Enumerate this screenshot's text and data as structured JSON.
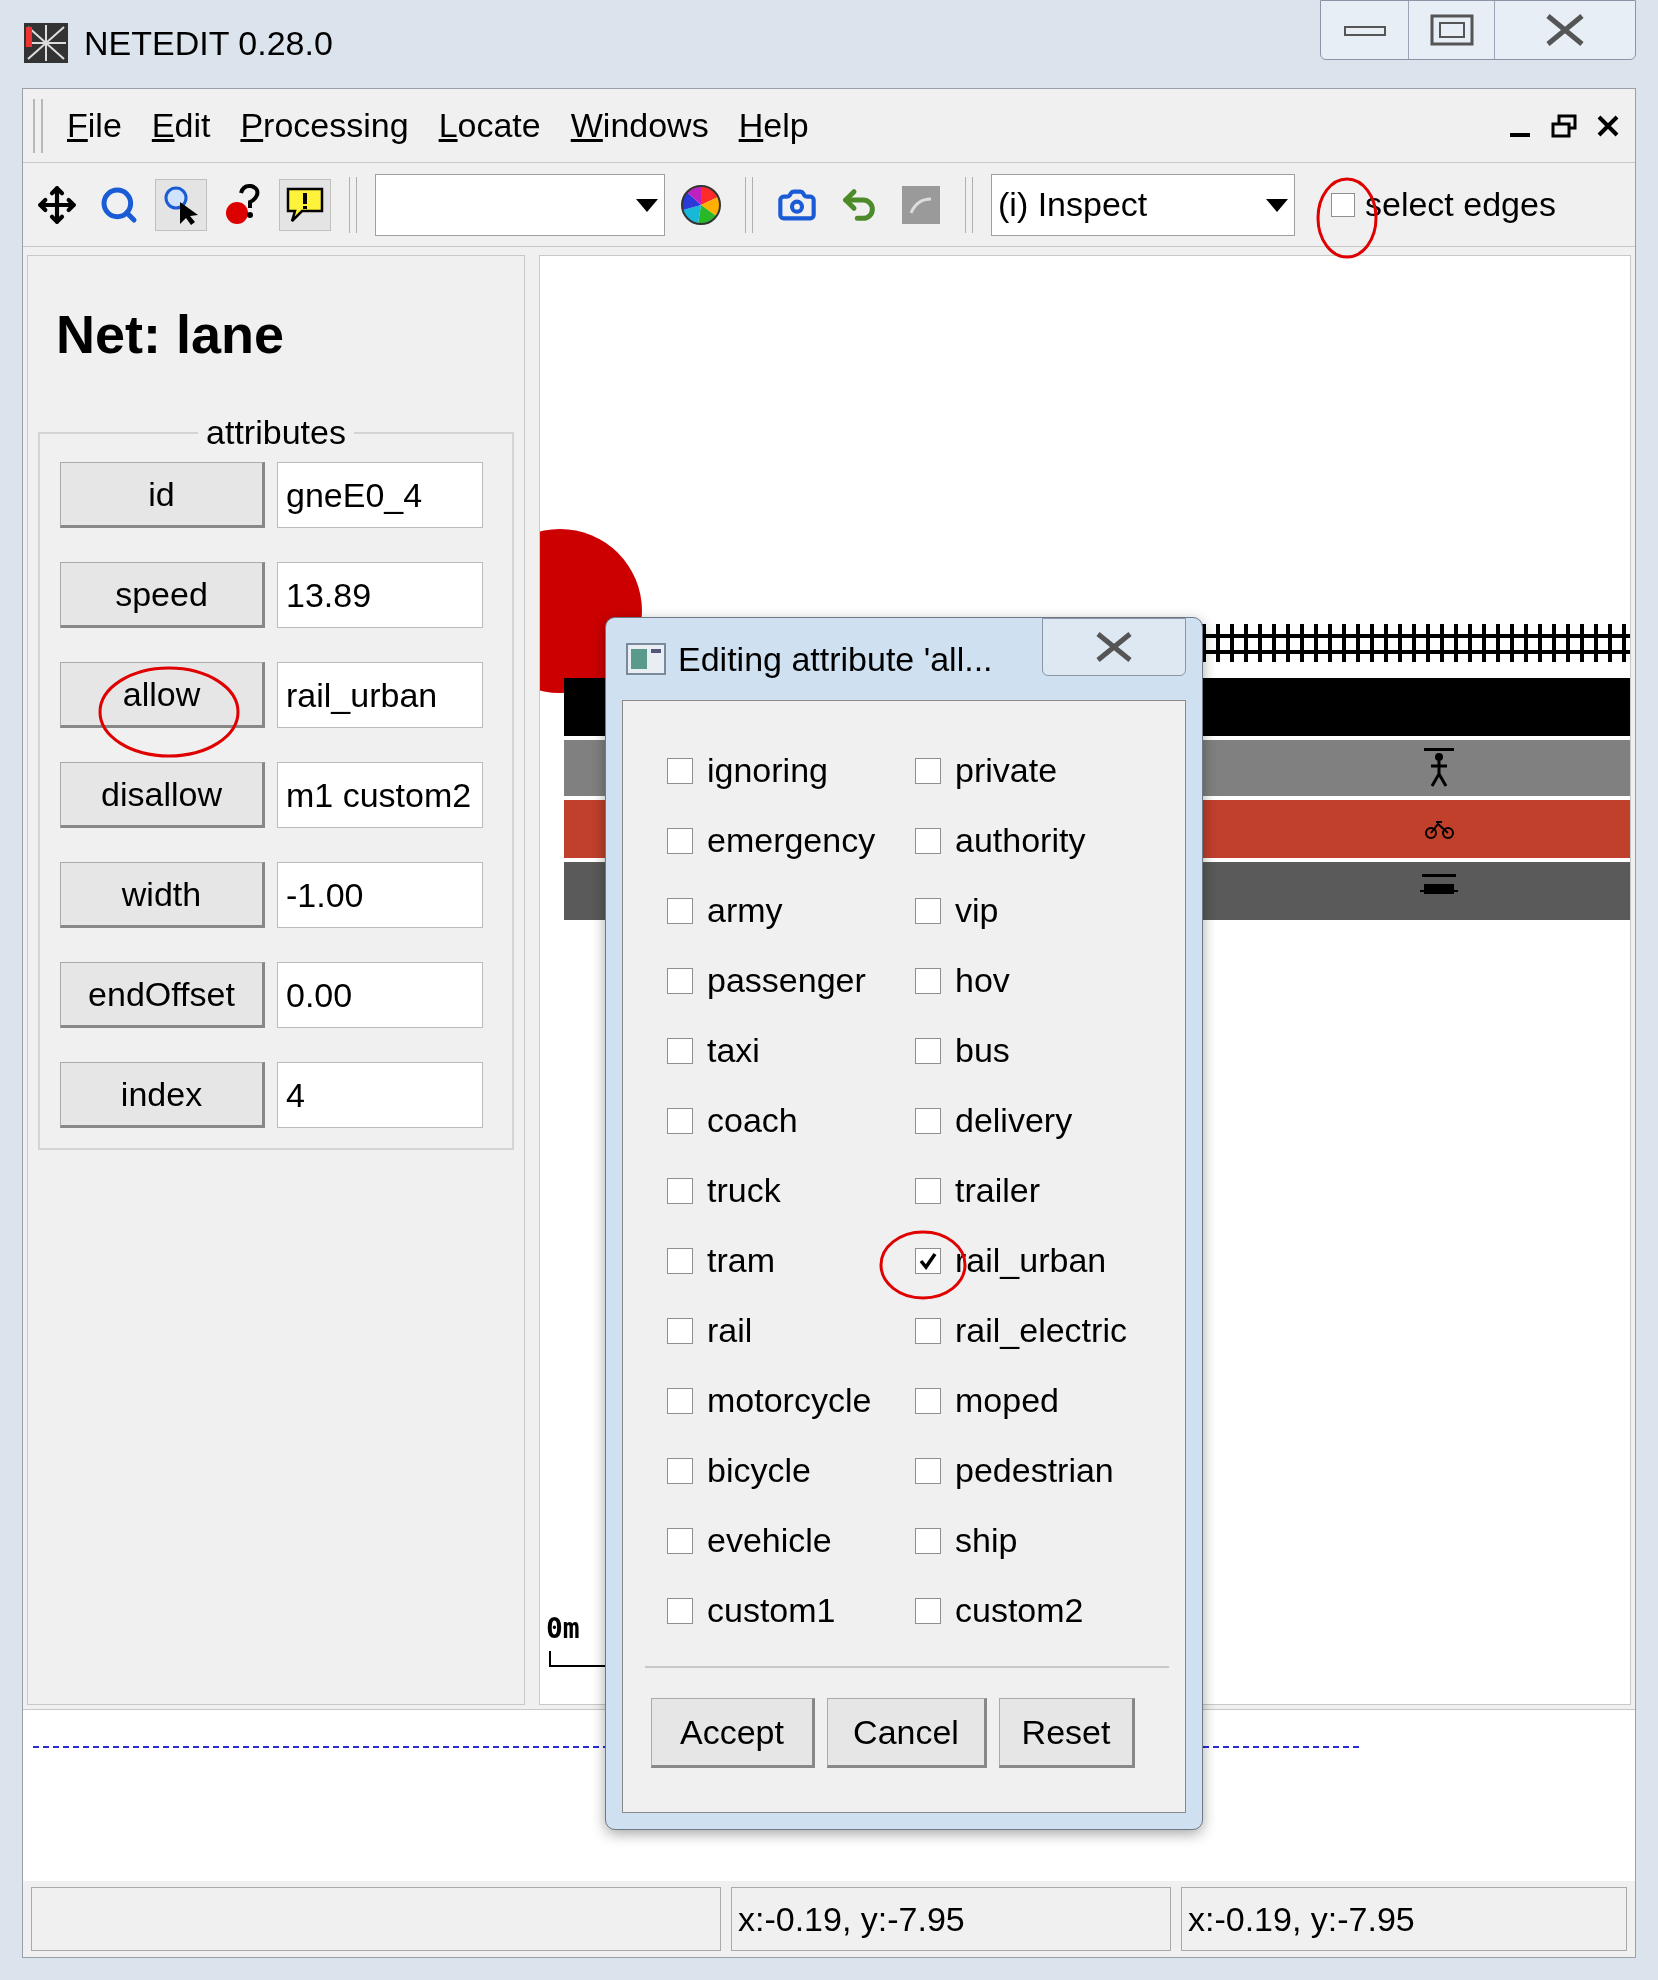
{
  "window": {
    "title": "NETEDIT 0.28.0"
  },
  "menu": [
    {
      "label": "File"
    },
    {
      "label": "Edit"
    },
    {
      "label": "Processing"
    },
    {
      "label": "Locate"
    },
    {
      "label": "Windows"
    },
    {
      "label": "Help"
    }
  ],
  "toolbar": {
    "mode": "(i) Inspect",
    "select_edges": {
      "label": "select edges",
      "checked": false
    }
  },
  "panel": {
    "title": "Net: lane",
    "group": "attributes",
    "attributes": [
      {
        "name": "id",
        "value": "gneE0_4"
      },
      {
        "name": "speed",
        "value": "13.89"
      },
      {
        "name": "allow",
        "value": "rail_urban"
      },
      {
        "name": "disallow",
        "value": "m1 custom2"
      },
      {
        "name": "width",
        "value": "-1.00"
      },
      {
        "name": "endOffset",
        "value": "0.00"
      },
      {
        "name": "index",
        "value": "4"
      }
    ]
  },
  "canvas": {
    "scale_label": "0m"
  },
  "dialog": {
    "title": "Editing attribute 'all...",
    "options": [
      {
        "label": "ignoring",
        "checked": false
      },
      {
        "label": "private",
        "checked": false
      },
      {
        "label": "emergency",
        "checked": false
      },
      {
        "label": "authority",
        "checked": false
      },
      {
        "label": "army",
        "checked": false
      },
      {
        "label": "vip",
        "checked": false
      },
      {
        "label": "passenger",
        "checked": false
      },
      {
        "label": "hov",
        "checked": false
      },
      {
        "label": "taxi",
        "checked": false
      },
      {
        "label": "bus",
        "checked": false
      },
      {
        "label": "coach",
        "checked": false
      },
      {
        "label": "delivery",
        "checked": false
      },
      {
        "label": "truck",
        "checked": false
      },
      {
        "label": "trailer",
        "checked": false
      },
      {
        "label": "tram",
        "checked": false
      },
      {
        "label": "rail_urban",
        "checked": true
      },
      {
        "label": "rail",
        "checked": false
      },
      {
        "label": "rail_electric",
        "checked": false
      },
      {
        "label": "motorcycle",
        "checked": false
      },
      {
        "label": "moped",
        "checked": false
      },
      {
        "label": "bicycle",
        "checked": false
      },
      {
        "label": "pedestrian",
        "checked": false
      },
      {
        "label": "evehicle",
        "checked": false
      },
      {
        "label": "ship",
        "checked": false
      },
      {
        "label": "custom1",
        "checked": false
      },
      {
        "label": "custom2",
        "checked": false
      }
    ],
    "buttons": [
      "Accept",
      "Cancel",
      "Reset"
    ]
  },
  "status_bar": [
    "x:-0.19, y:-7.95",
    "x:-0.19, y:-7.95"
  ]
}
